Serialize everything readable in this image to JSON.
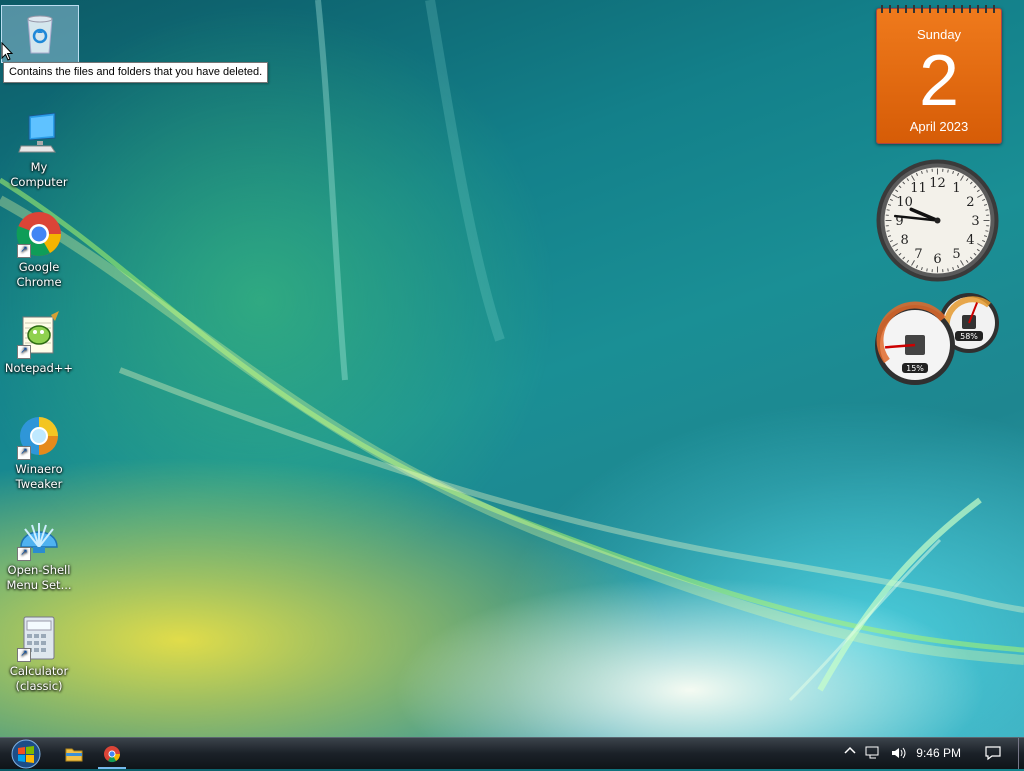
{
  "desktop": {
    "icons": [
      {
        "label": ""
      },
      {
        "label": "My Computer"
      },
      {
        "label": "Google Chrome"
      },
      {
        "label": "Notepad++"
      },
      {
        "label": "Winaero Tweaker"
      },
      {
        "label": "Open-Shell Menu Set..."
      },
      {
        "label": "Calculator (classic)"
      }
    ],
    "tooltip": "Contains the files and folders that you have deleted."
  },
  "gadgets": {
    "calendar": {
      "weekday": "Sunday",
      "day": "2",
      "month_year": "April 2023"
    },
    "clock": {
      "numbers": [
        "12",
        "1",
        "2",
        "3",
        "4",
        "5",
        "6",
        "7",
        "8",
        "9",
        "10",
        "11"
      ],
      "time": "9:46"
    },
    "meter": {
      "cpu": "15%",
      "memory": "58%",
      "cpu_value": 0.15,
      "memory_value": 0.58
    }
  },
  "taskbar": {
    "pinned": [
      {
        "icon": "file-explorer-icon"
      },
      {
        "icon": "chrome-icon"
      }
    ],
    "time": "9:46 PM"
  },
  "colors": {
    "calendar": "#e46a12",
    "taskbar": "#1b2128",
    "tooltip_bg": "#ffffff"
  }
}
